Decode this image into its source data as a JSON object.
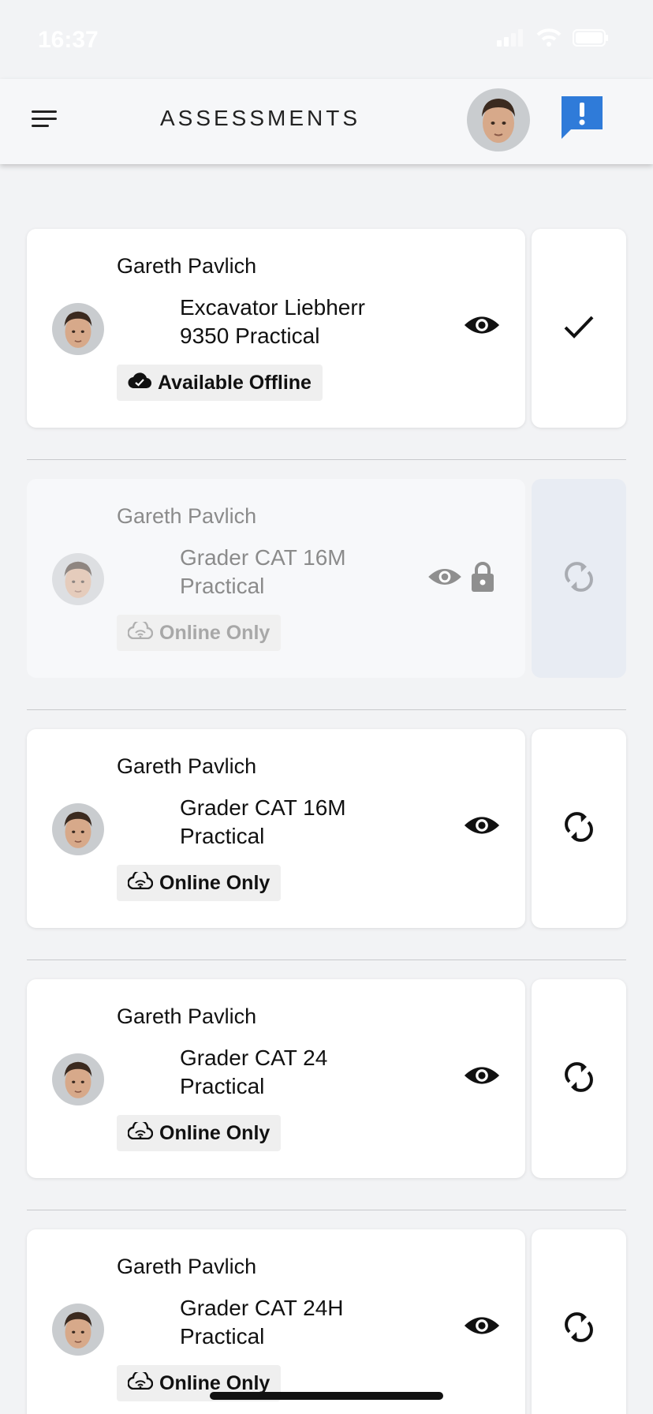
{
  "status_bar": {
    "time": "16:37"
  },
  "header": {
    "title": "ASSESSMENTS"
  },
  "colors": {
    "accent": "#2f7bd9",
    "disabled_side": "#e8ecf3"
  },
  "assessments": [
    {
      "assessor": "Gareth Pavlich",
      "title": "Excavator Liebherr 9350 Practical",
      "badge": "Available Offline",
      "badge_icon": "cloud-check-icon",
      "action_icon": "check-icon",
      "state": "downloaded"
    },
    {
      "assessor": "Gareth Pavlich",
      "title": "Grader CAT 16M Practical",
      "badge": "Online Only",
      "badge_icon": "cloud-wifi-icon",
      "action_icon": "sync-icon",
      "state": "locked"
    },
    {
      "assessor": "Gareth Pavlich",
      "title": "Grader CAT 16M Practical",
      "badge": "Online Only",
      "badge_icon": "cloud-wifi-icon",
      "action_icon": "sync-icon",
      "state": "online"
    },
    {
      "assessor": "Gareth Pavlich",
      "title": "Grader CAT 24 Practical",
      "badge": "Online Only",
      "badge_icon": "cloud-wifi-icon",
      "action_icon": "sync-icon",
      "state": "online"
    },
    {
      "assessor": "Gareth Pavlich",
      "title": "Grader CAT 24H Practical",
      "badge": "Online Only",
      "badge_icon": "cloud-wifi-icon",
      "action_icon": "sync-icon",
      "state": "online"
    }
  ]
}
